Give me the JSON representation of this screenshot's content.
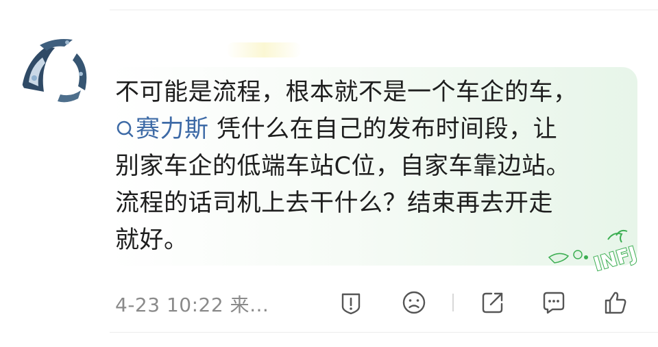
{
  "comment": {
    "line1": "不可能是流程，根本就不是一个车企的车，",
    "topic": "赛力斯",
    "line2_rest": " 凭什么在自己的发布时间段，让",
    "line3": "别家车企的低端车站C位，自家车靠边站。",
    "line4": "流程的话司机上去干什么？结束再去开走",
    "line5": "就好。"
  },
  "meta": {
    "timestamp": "4-23 10:22 来…"
  },
  "badge": {
    "text": "INFJ"
  },
  "icons": {
    "report": "report-icon",
    "dislike": "frown-icon",
    "share": "share-icon",
    "reply": "comment-icon",
    "like": "thumbs-up-icon"
  },
  "colors": {
    "topic_link": "#3d6aa6",
    "badge_green": "#3cae52"
  }
}
